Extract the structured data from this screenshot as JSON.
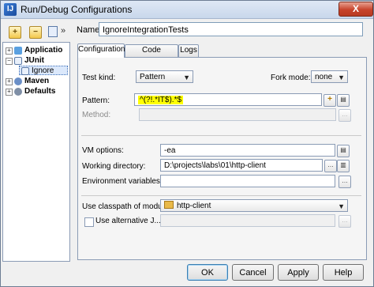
{
  "window": {
    "title": "Run/Debug Configurations",
    "close_label": "X"
  },
  "toolbar": {
    "add_label": "+",
    "remove_label": "−",
    "more_label": "»"
  },
  "tree": {
    "items": [
      {
        "label": "Applicatio",
        "expander": "+"
      },
      {
        "label": "JUnit",
        "expander": "−"
      },
      {
        "label": "Ignore"
      },
      {
        "label": "Maven",
        "expander": "+"
      },
      {
        "label": "Defaults",
        "expander": "+"
      }
    ]
  },
  "name": {
    "label": "Name:",
    "value": "IgnoreIntegrationTests"
  },
  "tabs": [
    {
      "label": "Configuration"
    },
    {
      "label": "Code Coverage"
    },
    {
      "label": "Logs"
    }
  ],
  "config": {
    "test_kind_label": "Test kind:",
    "test_kind_value": "Pattern",
    "fork_mode_label": "Fork mode:",
    "fork_mode_value": "none",
    "pattern_label": "Pattern:",
    "pattern_value": "^(?!.*IT$).*$",
    "method_label": "Method:",
    "vm_options_label": "VM options:",
    "vm_options_value": "-ea",
    "working_dir_label": "Working directory:",
    "working_dir_value": "D:\\projects\\labs\\01\\http-client",
    "env_vars_label": "Environment variables:",
    "classpath_label": "Use classpath of module:",
    "classpath_value": "http-client",
    "alt_jre_label": "Use alternative J..."
  },
  "buttons": {
    "ok": "OK",
    "cancel": "Cancel",
    "apply": "Apply",
    "help": "Help"
  },
  "colors": {
    "highlight": "#ffff00",
    "selection": "#dbe8fb"
  }
}
